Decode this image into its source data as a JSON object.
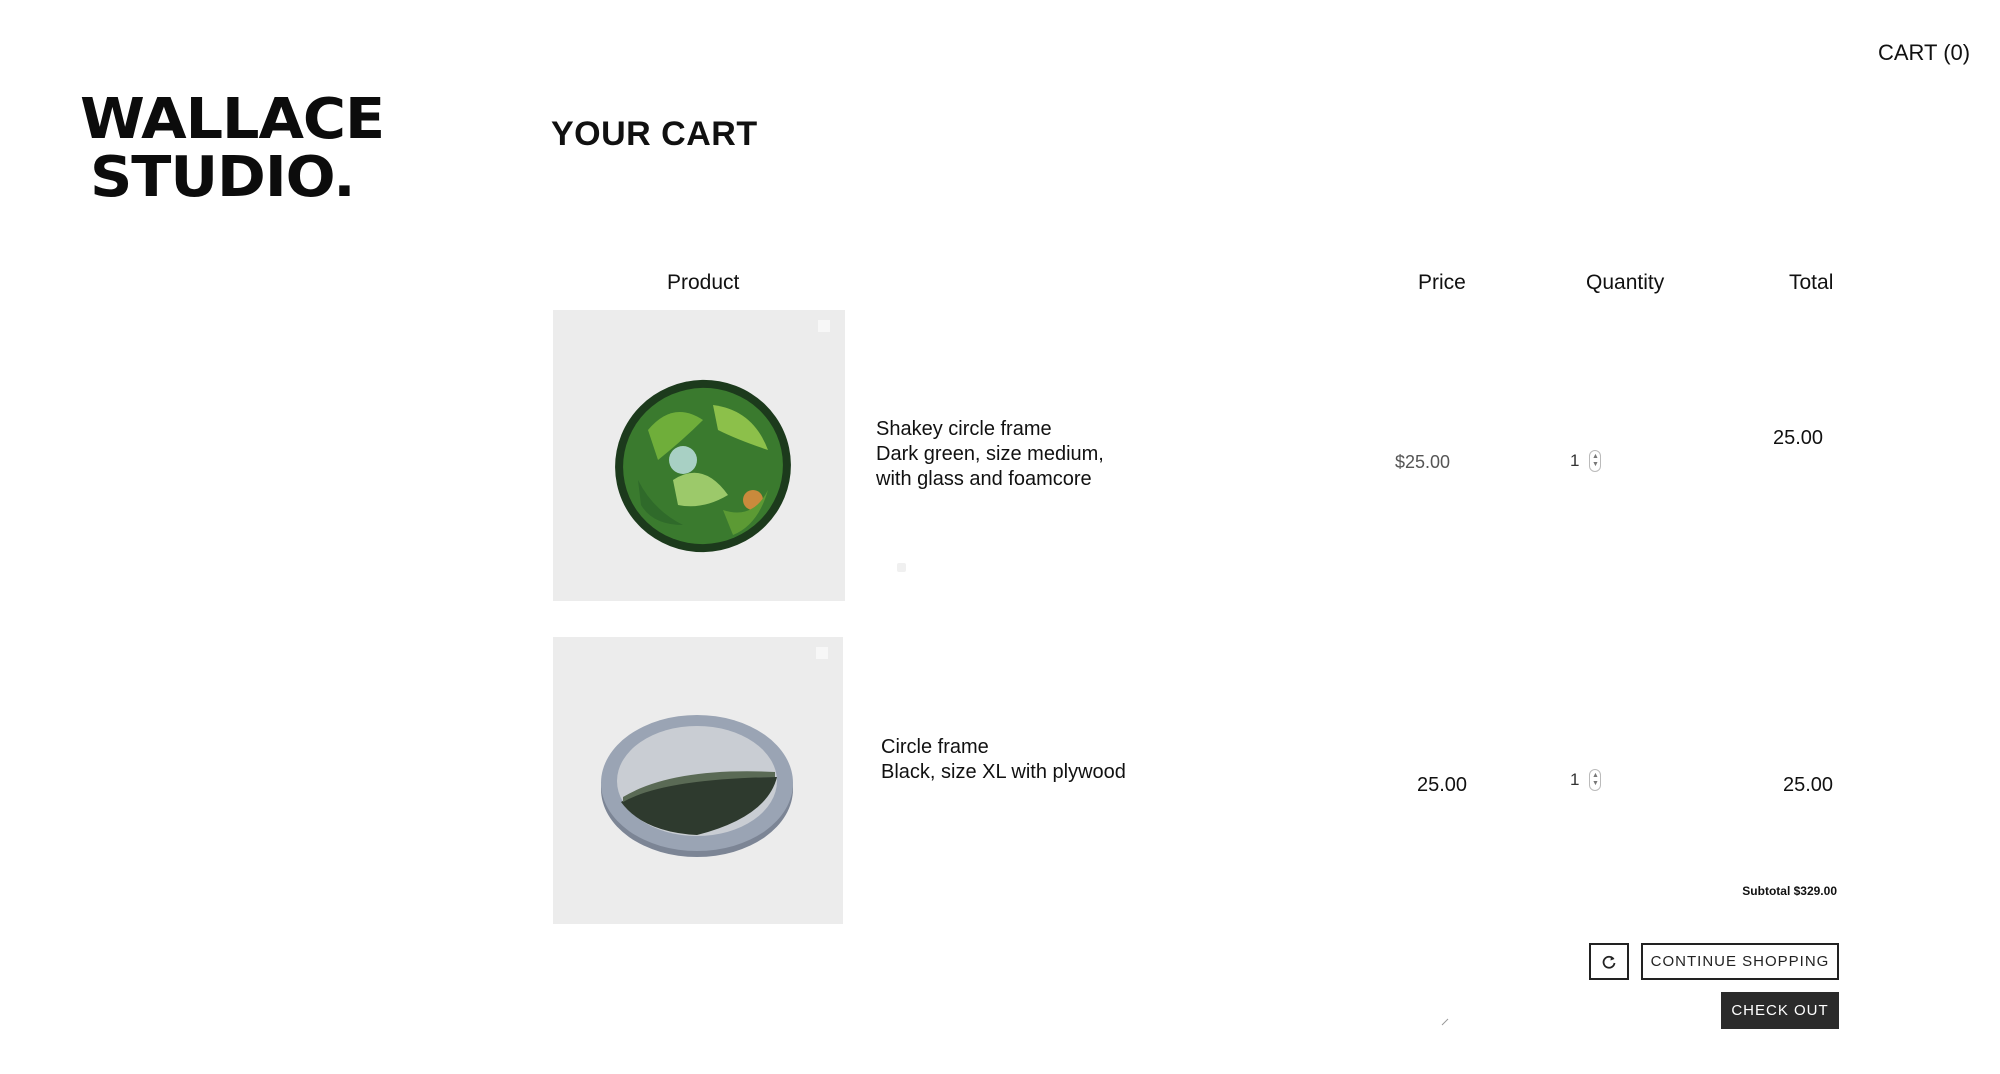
{
  "header": {
    "cart_link": "CART (0)",
    "logo": {
      "line1": "WALLACE",
      "line2": "STUDIO."
    },
    "page_title": "YOUR CART"
  },
  "table": {
    "columns": {
      "product": "Product",
      "price": "Price",
      "quantity": "Quantity",
      "total": "Total"
    },
    "rows": [
      {
        "desc_lines": [
          "Shakey circle frame",
          "Dark green, size medium,",
          "with glass and foamcore"
        ],
        "price": "$25.00",
        "quantity": "1",
        "total": "25.00",
        "image_icon": "green-leaf-circle-frame-photo"
      },
      {
        "desc_lines": [
          "Circle frame",
          "Black, size XL with plywood"
        ],
        "price": "25.00",
        "quantity": "1",
        "total": "25.00",
        "image_icon": "grey-circle-frame-photo"
      }
    ]
  },
  "summary": {
    "subtotal": "Subtotal $329.00"
  },
  "actions": {
    "refresh_icon": "refresh-icon",
    "continue_label": "CONTINUE SHOPPING",
    "checkout_label": "CHECK OUT"
  },
  "colors": {
    "checkout_bg": "#2b2b2b",
    "text": "#111111",
    "image_bg": "#ececec"
  }
}
